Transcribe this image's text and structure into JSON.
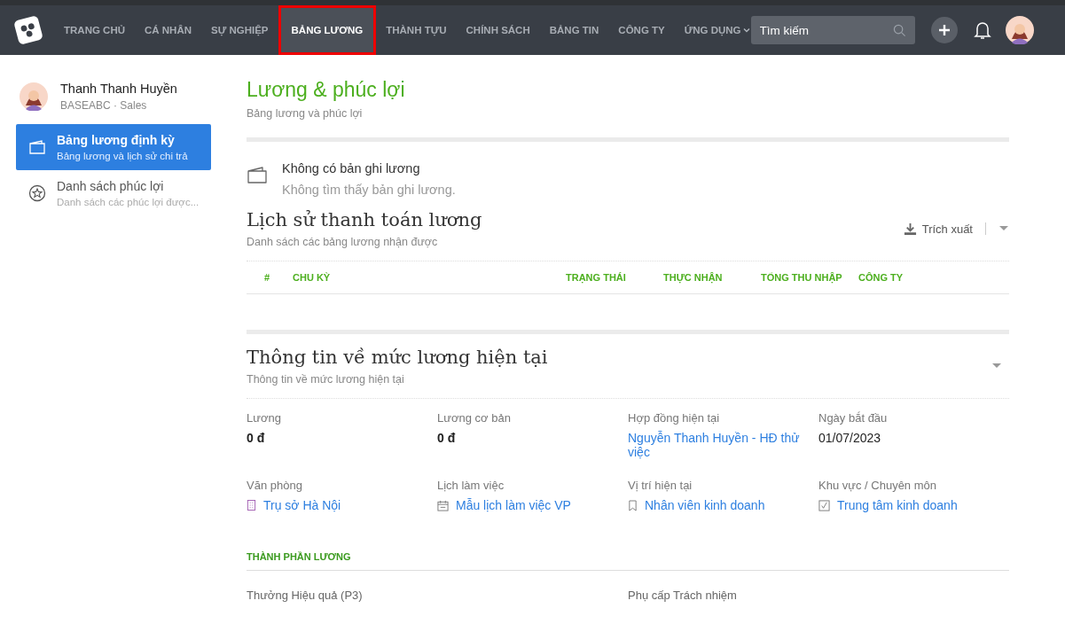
{
  "nav": {
    "tabs": [
      {
        "label": "TRANG CHỦ",
        "selected": false
      },
      {
        "label": "CÁ NHÂN",
        "selected": false
      },
      {
        "label": "SỰ NGHIỆP",
        "selected": false
      },
      {
        "label": "BẢNG LƯƠNG",
        "selected": true
      },
      {
        "label": "THÀNH TỰU",
        "selected": false
      },
      {
        "label": "CHÍNH SÁCH",
        "selected": false
      },
      {
        "label": "BẢNG TIN",
        "selected": false
      },
      {
        "label": "CÔNG TY",
        "selected": false
      },
      {
        "label": "ỨNG DỤNG",
        "selected": false
      }
    ],
    "search": {
      "placeholder": "Tìm kiếm"
    }
  },
  "sidebar": {
    "user": {
      "name": "Thanh Thanh Huyền",
      "org": "BASEABC · Sales"
    },
    "items": [
      {
        "title": "Bảng lương định kỳ",
        "subtitle": "Bảng lương và lịch sử chi trả",
        "selected": true
      },
      {
        "title": "Danh sách phúc lợi",
        "subtitle": "Danh sách các phúc lợi được...",
        "selected": false
      }
    ]
  },
  "page": {
    "title": "Lương & phúc lợi",
    "subtitle": "Bảng lương và phúc lợi"
  },
  "empty": {
    "title": "Không có bản ghi lương",
    "text": "Không tìm thấy bản ghi lương."
  },
  "history": {
    "title": "Lịch sử thanh toán lương",
    "subtitle": "Danh sách các bảng lương nhận được",
    "export": "Trích xuất",
    "columns": [
      "#",
      "CHU KỲ",
      "TRẠNG THÁI",
      "THỰC NHẬN",
      "TỔNG THU NHẬP",
      "CÔNG TY"
    ]
  },
  "current": {
    "title": "Thông tin về mức lương hiện tại",
    "subtitle": "Thông tin về mức lương hiện tại",
    "fields": [
      {
        "label": "Lương",
        "value": "0 đ",
        "kind": "amount"
      },
      {
        "label": "Lương cơ bản",
        "value": "0 đ",
        "kind": "amount"
      },
      {
        "label": "Hợp đồng hiện tại",
        "value": "Nguyễn Thanh Huyền - HĐ thử việc",
        "kind": "link"
      },
      {
        "label": "Ngày bắt đầu",
        "value": "01/07/2023",
        "kind": "text"
      },
      {
        "label": "Văn phòng",
        "value": "Trụ sở Hà Nội",
        "kind": "office"
      },
      {
        "label": "Lịch làm việc",
        "value": "Mẫu lịch làm việc VP",
        "kind": "schedule"
      },
      {
        "label": "Vị trí hiện tại",
        "value": "Nhân viên kinh doanh",
        "kind": "position"
      },
      {
        "label": "Khu vực / Chuyên môn",
        "value": "Trung tâm kinh doanh",
        "kind": "area"
      }
    ],
    "components_title": "THÀNH PHẦN LƯƠNG",
    "components": [
      "Thưởng Hiệu quả (P3)",
      "Phụ cấp Trách nhiệm"
    ]
  }
}
